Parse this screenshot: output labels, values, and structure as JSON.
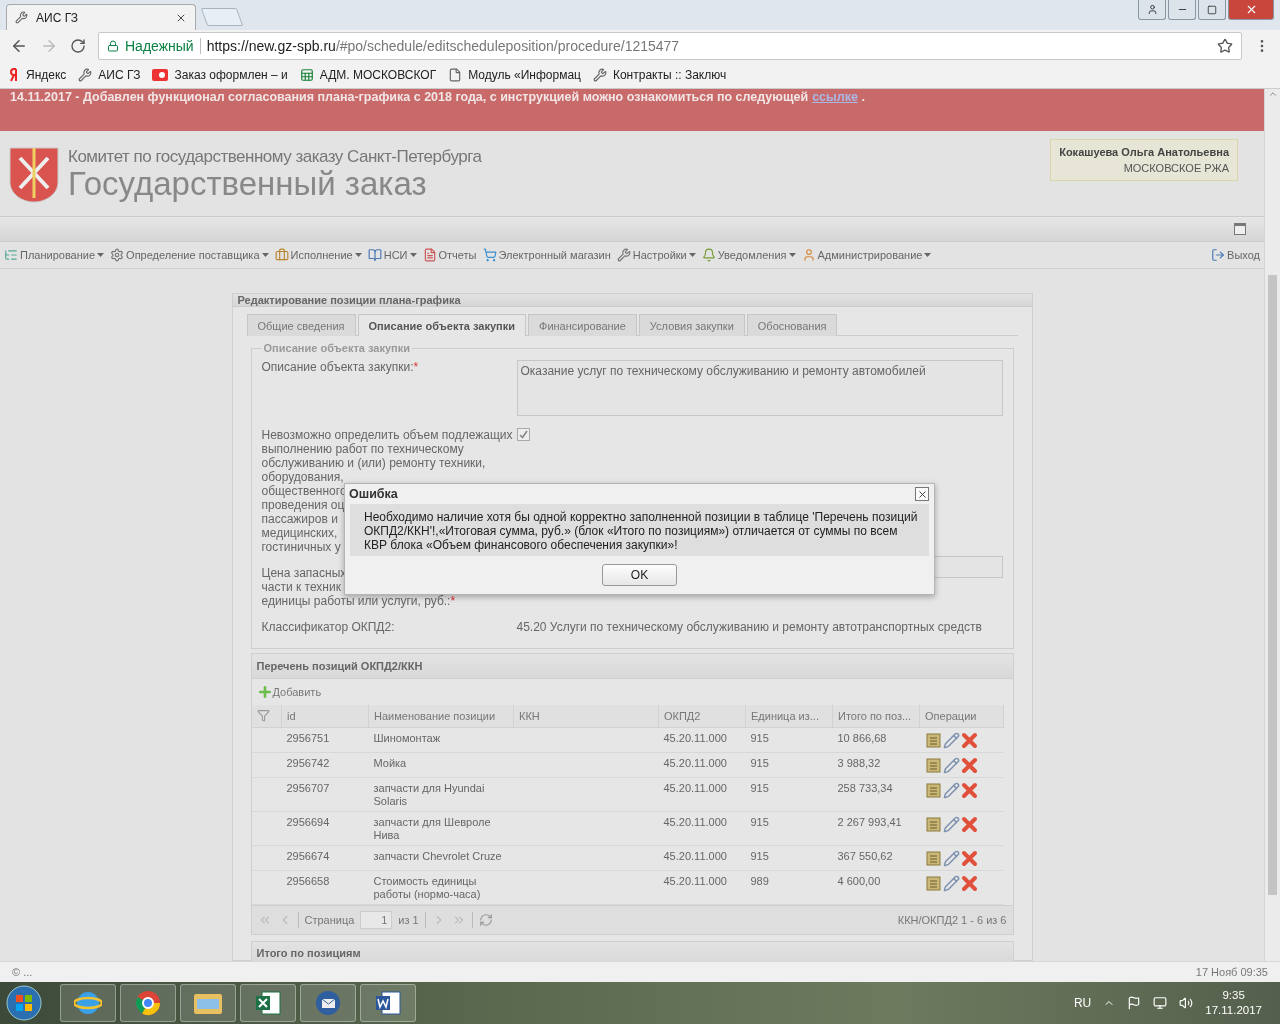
{
  "browser": {
    "tab_title": "АИС ГЗ",
    "security": "Надежный",
    "url_host": "https://new.gz-spb.ru",
    "url_path": "/#po/schedule/editscheduleposition/procedure/1215477",
    "bookmarks": [
      {
        "kind": "yandex",
        "label": "Яндекс"
      },
      {
        "kind": "tool",
        "label": "АИС ГЗ"
      },
      {
        "kind": "red",
        "label": "Заказ оформлен – и"
      },
      {
        "kind": "sheet",
        "label": "АДМ. МОСКОВСКОГ"
      },
      {
        "kind": "doc",
        "label": "Модуль «Информац"
      },
      {
        "kind": "tool",
        "label": "Контракты :: Заключ"
      }
    ]
  },
  "notice": {
    "text": "14.11.2017 - Добавлен функционал согласования плана-графика с 2018 года, с инструкцией можно ознакомиться по следующей",
    "link": "ссылке",
    "tail": "."
  },
  "header": {
    "org": "Комитет по государственному заказу Санкт-Петербурга",
    "title": "Государственный заказ",
    "user": "Кокашуева Ольга Анатольевна",
    "unit": "МОСКОВСКОЕ РЖА"
  },
  "menu": [
    {
      "kind": "plan",
      "label": "Планирование",
      "dropdown": true
    },
    {
      "kind": "gear",
      "label": "Определение поставщика",
      "dropdown": true
    },
    {
      "kind": "case",
      "label": "Исполнение",
      "dropdown": true
    },
    {
      "kind": "book",
      "label": "НСИ",
      "dropdown": true
    },
    {
      "kind": "report",
      "label": "Отчеты",
      "dropdown": false
    },
    {
      "kind": "cart",
      "label": "Электронный магазин",
      "dropdown": false
    },
    {
      "kind": "wrench",
      "label": "Настройки",
      "dropdown": true
    },
    {
      "kind": "bell",
      "label": "Уведомления",
      "dropdown": true
    },
    {
      "kind": "user",
      "label": "Администрирование",
      "dropdown": true
    }
  ],
  "exit": "Выход",
  "panel": {
    "title": "Редактирование позиции плана-графика",
    "tabs": [
      {
        "label": "Общие сведения",
        "selected": false
      },
      {
        "label": "Описание объекта закупки",
        "selected": true
      },
      {
        "label": "Финансирование",
        "selected": false
      },
      {
        "label": "Условия закупки",
        "selected": false
      },
      {
        "label": "Обоснования",
        "selected": false
      }
    ],
    "legend": "Описание объекта закупки",
    "description": {
      "label": "Описание объекта закупки:",
      "mark": "*",
      "value": "Оказание услуг по техническому обслуживанию и ремонту автомобилей"
    },
    "checkbox": {
      "lines": [
        "Невозможно определить объем подлежащих",
        "выполнению работ по техническому",
        "обслуживанию и (или) ремонту техники,",
        "оборудования,",
        "общественного",
        "проведения оц",
        "пассажиров и",
        "медицинских,",
        "гостиничных у"
      ],
      "checked": true
    },
    "price": {
      "lines": [
        "Цена запасных",
        "части к техник",
        "единицы работы или услуги, руб.:"
      ],
      "mark": "*"
    },
    "okpd": {
      "label": "Классификатор ОКПД2:",
      "value": "45.20 Услуги по техническому обслуживанию и ремонту автотранспортных средств"
    },
    "grid": {
      "title": "Перечень позиций ОКПД2/ККН",
      "add": "Добавить",
      "columns": [
        "id",
        "Наименование позиции",
        "ККН",
        "ОКПД2",
        "Единица из...",
        "Итого по поз...",
        "Операции"
      ],
      "rows": [
        {
          "id": "2956751",
          "name": "Шиномонтаж",
          "okpd": "45.20.11.000",
          "unit": "915",
          "total": "10 866,68"
        },
        {
          "id": "2956742",
          "name": "Мойка",
          "okpd": "45.20.11.000",
          "unit": "915",
          "total": "3 988,32"
        },
        {
          "id": "2956707",
          "name": "запчасти для Hyundai Solaris",
          "okpd": "45.20.11.000",
          "unit": "915",
          "total": "258 733,34"
        },
        {
          "id": "2956694",
          "name": "запчасти для Шевроле Нива",
          "okpd": "45.20.11.000",
          "unit": "915",
          "total": "2 267 993,41"
        },
        {
          "id": "2956674",
          "name": "запчасти Chevrolet Cruze",
          "okpd": "45.20.11.000",
          "unit": "915",
          "total": "367 550,62"
        },
        {
          "id": "2956658",
          "name": "Стоимость единицы работы (нормо-часа)",
          "okpd": "45.20.11.000",
          "unit": "989",
          "total": "4 600,00"
        }
      ],
      "pager": {
        "page_label": "Страница",
        "page": "1",
        "of": "из 1",
        "summary": "ККН/ОКПД2 1 - 6 из 6"
      }
    },
    "next_section": "Итого по позициям"
  },
  "dialog": {
    "title": "Ошибка",
    "message": "Необходимо наличие хотя бы одной корректно заполненной позиции в таблице 'Перечень позиций ОКПД2/ККН'!,«Итоговая сумма, руб.» (блок «Итого по позициям») отличается от суммы по всем КВР блока «Объем финансового обеспечения закупки»!",
    "button": "OK"
  },
  "status": {
    "left": "© ...",
    "right": "17 Нояб 09:35"
  },
  "taskbar": {
    "apps": [
      {
        "kind": "ie"
      },
      {
        "kind": "chrome"
      },
      {
        "kind": "folder"
      },
      {
        "kind": "excel"
      },
      {
        "kind": "mail"
      },
      {
        "kind": "word"
      }
    ],
    "lang": "RU",
    "time": "9:35",
    "date": "17.11.2017"
  }
}
